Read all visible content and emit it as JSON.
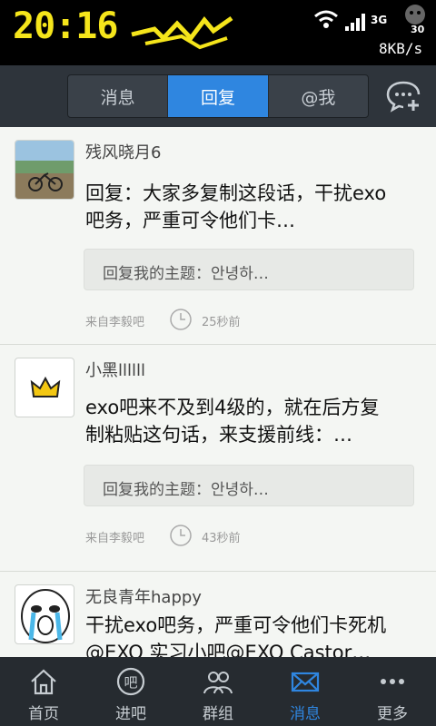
{
  "status_bar": {
    "time": "20:16",
    "network": "3G",
    "battery": "30",
    "speed": "8KB/s"
  },
  "top_tabs": [
    {
      "label": "消息",
      "active": false
    },
    {
      "label": "回复",
      "active": true
    },
    {
      "label": "@我",
      "active": false
    }
  ],
  "messages": [
    {
      "username": "残风晓月6",
      "content": "回复：大家多复制这段话，干扰exo吧务，严重可令他们卡…",
      "quote": "回复我的主题：안녕하…",
      "source": "来自李毅吧",
      "time": "25秒前"
    },
    {
      "username": "小黑llllll",
      "content": "exo吧来不及到4级的，就在后方复制粘贴这句话，来支援前线：…",
      "quote": "回复我的主题：안녕하…",
      "source": "来自李毅吧",
      "time": "43秒前"
    },
    {
      "username": "无良青年happy",
      "content": "干扰exo吧务，严重可令他们卡死机@EXO 实习小吧@EXO Castor…",
      "quote": "",
      "source": "",
      "time": ""
    }
  ],
  "bottom_nav": [
    {
      "label": "首页",
      "icon": "home-icon",
      "active": false
    },
    {
      "label": "进吧",
      "icon": "ba-icon",
      "active": false
    },
    {
      "label": "群组",
      "icon": "group-icon",
      "active": false
    },
    {
      "label": "消息",
      "icon": "mail-icon",
      "active": true
    },
    {
      "label": "更多",
      "icon": "more-icon",
      "active": false
    }
  ],
  "colors": {
    "accent": "#2f86e0",
    "topbar": "#2e343b",
    "bottombar": "#262b30",
    "clock_yellow": "#f5e51b"
  }
}
